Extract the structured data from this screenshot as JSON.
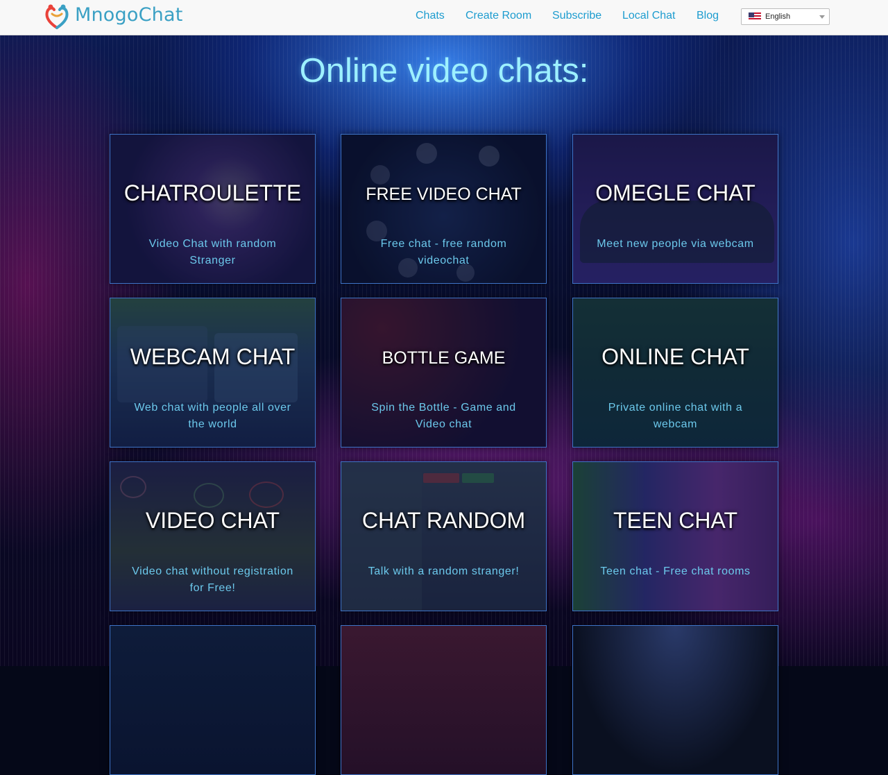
{
  "header": {
    "logo_text": "MnogoChat",
    "nav": [
      "Chats",
      "Create Room",
      "Subscribe",
      "Local Chat",
      "Blog"
    ],
    "language": "English"
  },
  "page_title": "Online video chats:",
  "cards": [
    {
      "title": "CHATROULETTE",
      "desc": "Video Chat with random Stranger"
    },
    {
      "title": "FREE VIDEO CHAT",
      "desc": "Free chat - free random videochat"
    },
    {
      "title": "OMEGLE CHAT",
      "desc": "Meet new people via webcam"
    },
    {
      "title": "WEBCAM CHAT",
      "desc": "Web chat with people all over the world"
    },
    {
      "title": "BOTTLE GAME",
      "desc": "Spin the Bottle - Game and Video chat"
    },
    {
      "title": "ONLINE CHAT",
      "desc": "Private online chat with a webcam"
    },
    {
      "title": "VIDEO CHAT",
      "desc": "Video chat without registration for Free!"
    },
    {
      "title": "CHAT RANDOM",
      "desc": "Talk with a random stranger!"
    },
    {
      "title": "TEEN CHAT",
      "desc": "Teen chat - Free chat rooms"
    }
  ],
  "colors": {
    "brand": "#3aa0c4",
    "nav_link": "#1d9ccf",
    "title": "#9df0ff",
    "card_desc": "#6cc9ec",
    "card_border": "#3e74c8"
  }
}
